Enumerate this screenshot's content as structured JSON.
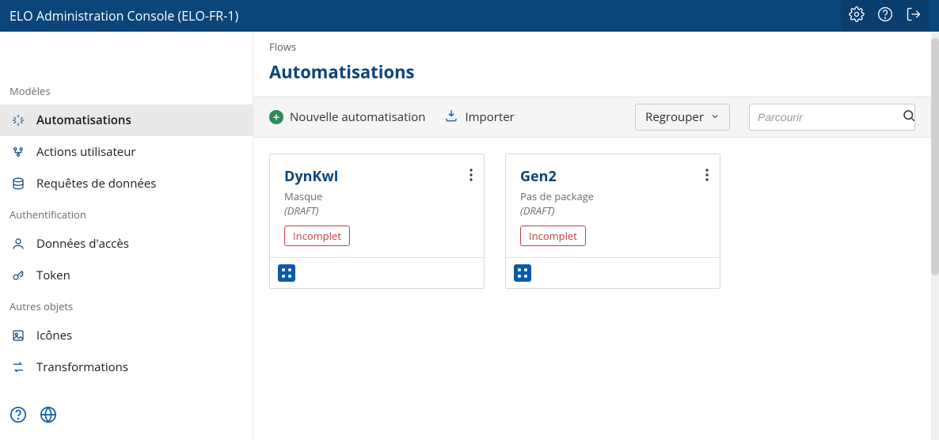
{
  "header": {
    "title": "ELO Administration Console (ELO-FR-1)"
  },
  "sidebar": {
    "sections": {
      "modeles": {
        "label": "Modèles"
      },
      "auth": {
        "label": "Authentification"
      },
      "autres": {
        "label": "Autres objets"
      }
    },
    "items": {
      "automatisations": {
        "label": "Automatisations"
      },
      "actions_utilisateur": {
        "label": "Actions utilisateur"
      },
      "requetes_donnees": {
        "label": "Requêtes de données"
      },
      "donnees_acces": {
        "label": "Données d'accès"
      },
      "token": {
        "label": "Token"
      },
      "icones": {
        "label": "Icônes"
      },
      "transformations": {
        "label": "Transformations"
      }
    }
  },
  "breadcrumb": "Flows",
  "page_title": "Automatisations",
  "toolbar": {
    "new_label": "Nouvelle automatisation",
    "import_label": "Importer",
    "group_label": "Regrouper",
    "search_placeholder": "Parcourir"
  },
  "cards": [
    {
      "title": "DynKwl",
      "subtitle": "Masque",
      "status": "(DRAFT)",
      "badge": "Incomplet"
    },
    {
      "title": "Gen2",
      "subtitle": "Pas de package",
      "status": "(DRAFT)",
      "badge": "Incomplet"
    }
  ]
}
